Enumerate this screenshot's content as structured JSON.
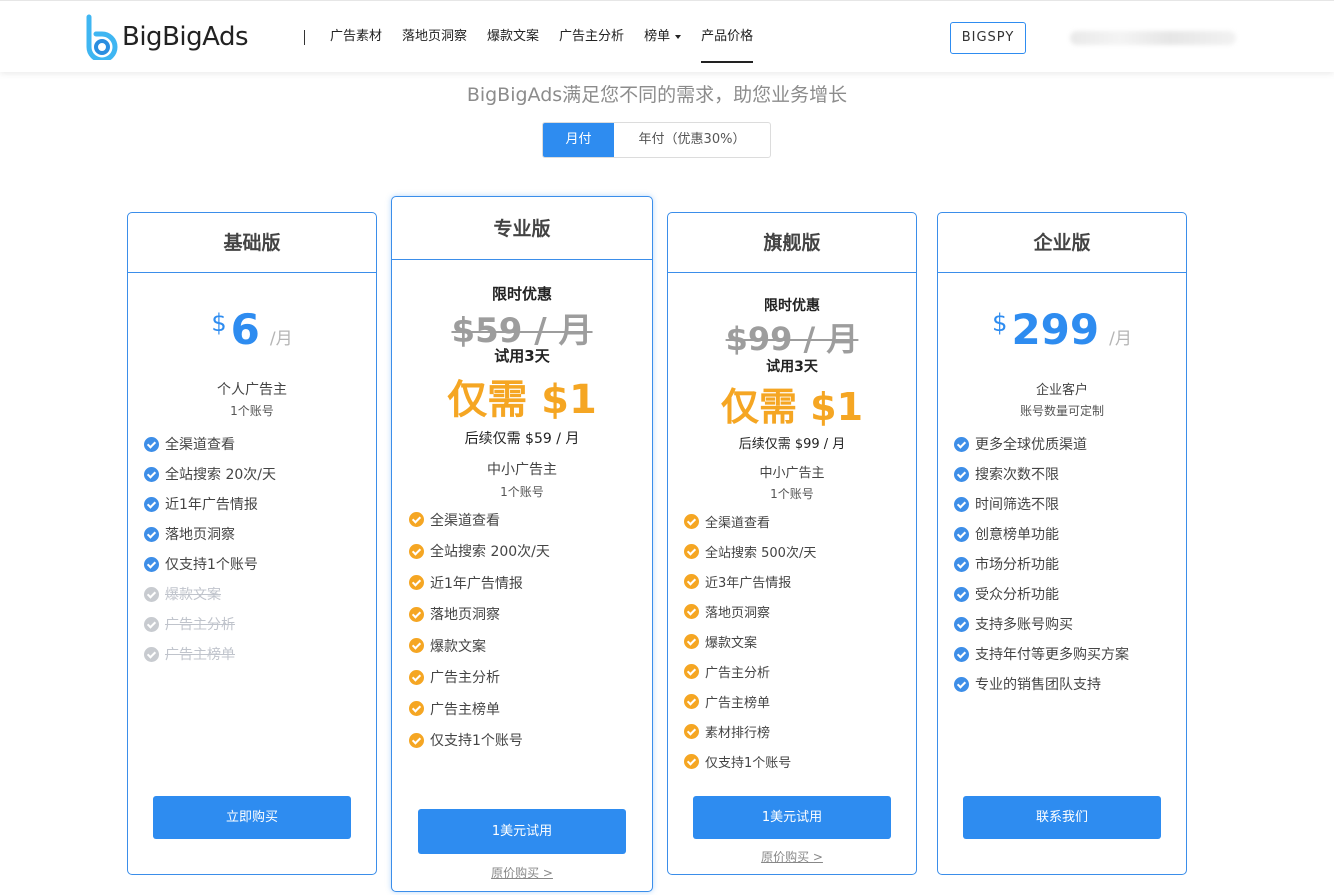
{
  "header": {
    "logo_text": "BigBigAds",
    "nav": [
      {
        "label": "广告素材",
        "active": false
      },
      {
        "label": "落地页洞察",
        "active": false
      },
      {
        "label": "爆款文案",
        "active": false
      },
      {
        "label": "广告主分析",
        "active": false
      },
      {
        "label": "榜单",
        "active": false,
        "dropdown": true
      },
      {
        "label": "产品价格",
        "active": true
      }
    ],
    "bigspy_label": "BIGSPY"
  },
  "subtitle": "BigBigAds满足您不同的需求，助您业务增长",
  "billing": {
    "monthly": "月付",
    "yearly": "年付（优惠30%）",
    "selected": "monthly"
  },
  "plans": {
    "basic": {
      "name": "基础版",
      "currency": "$",
      "price": "6",
      "period": "/月",
      "audience": "个人广告主",
      "accounts": "1个账号",
      "features": [
        {
          "text": "全渠道查看",
          "enabled": true
        },
        {
          "text": "全站搜索 20次/天",
          "enabled": true
        },
        {
          "text": "近1年广告情报",
          "enabled": true
        },
        {
          "text": "落地页洞察",
          "enabled": true
        },
        {
          "text": "仅支持1个账号",
          "enabled": true
        },
        {
          "text": "爆款文案",
          "enabled": false
        },
        {
          "text": "广告主分析",
          "enabled": false
        },
        {
          "text": "广告主榜单",
          "enabled": false
        }
      ],
      "button": "立即购买"
    },
    "pro": {
      "name": "专业版",
      "promo": "限时优惠",
      "old_price": "$59 / 月",
      "trial": "试用3天",
      "only": "仅需 $1",
      "later": "后续仅需 $59 / 月",
      "audience": "中小广告主",
      "accounts": "1个账号",
      "features": [
        "全渠道查看",
        "全站搜索 200次/天",
        "近1年广告情报",
        "落地页洞察",
        "爆款文案",
        "广告主分析",
        "广告主榜单",
        "仅支持1个账号"
      ],
      "button": "1美元试用",
      "orig_link": "原价购买 >"
    },
    "flagship": {
      "name": "旗舰版",
      "promo": "限时优惠",
      "old_price": "$99 / 月",
      "trial": "试用3天",
      "only": "仅需 $1",
      "later": "后续仅需 $99 / 月",
      "audience": "中小广告主",
      "accounts": "1个账号",
      "features": [
        "全渠道查看",
        "全站搜索 500次/天",
        "近3年广告情报",
        "落地页洞察",
        "爆款文案",
        "广告主分析",
        "广告主榜单",
        "素材排行榜",
        "仅支持1个账号"
      ],
      "button": "1美元试用",
      "orig_link": "原价购买 >"
    },
    "enterprise": {
      "name": "企业版",
      "currency": "$",
      "price": "299",
      "period": "/月",
      "audience": "企业客户",
      "accounts": "账号数量可定制",
      "features": [
        "更多全球优质渠道",
        "搜索次数不限",
        "时间筛选不限",
        "创意榜单功能",
        "市场分析功能",
        "受众分析功能",
        "支持多账号购买",
        "支持年付等更多购买方案",
        "专业的销售团队支持"
      ],
      "button": "联系我们"
    }
  },
  "colors": {
    "accent": "#2e8cf0",
    "promo": "#f5a623",
    "disabled": "#c8cbd0"
  }
}
